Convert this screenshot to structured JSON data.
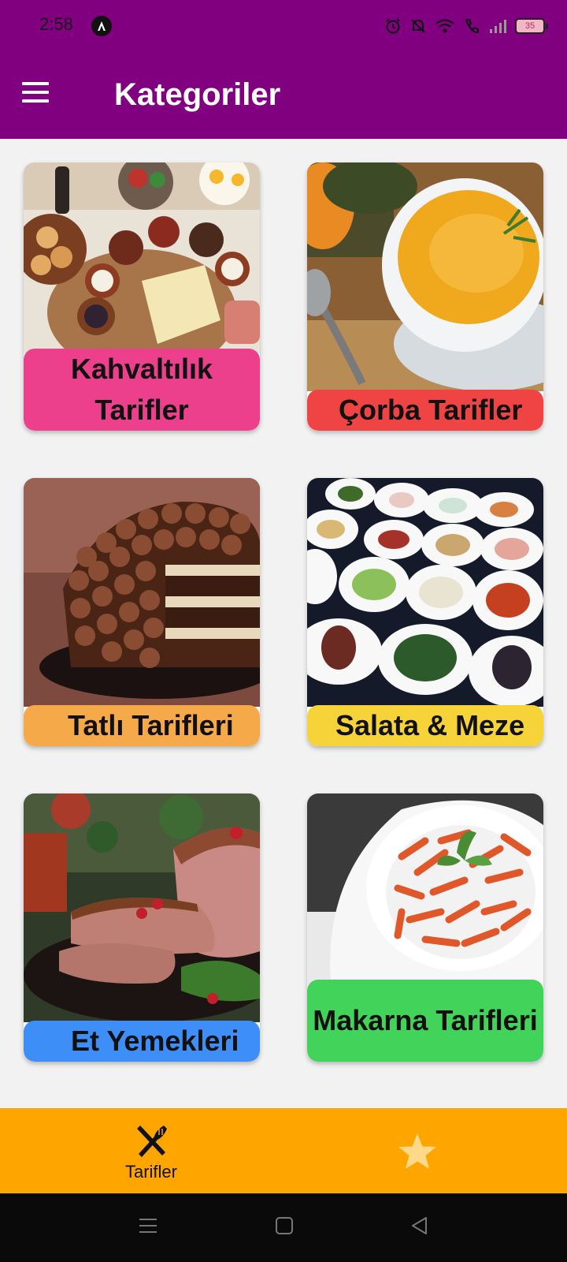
{
  "status_bar": {
    "time": "2:58",
    "battery": "35",
    "icons": [
      "alarm-icon",
      "mute-icon",
      "wifi-icon",
      "call-icon",
      "signal-icon",
      "battery-icon"
    ]
  },
  "app_bar": {
    "title": "Kategoriler",
    "menu_icon": "hamburger-menu-icon",
    "background": "#800080"
  },
  "categories": [
    {
      "label": "Kahvaltılık Tarifler",
      "color": "#ec3f8c",
      "image": "breakfast-spread"
    },
    {
      "label": "Çorba Tarifler",
      "color": "#f04444",
      "image": "pumpkin-soup"
    },
    {
      "label": "Tatlı Tarifleri",
      "color": "#f5a948",
      "image": "chocolate-cake"
    },
    {
      "label": "Salata & Meze",
      "color": "#f7d33a",
      "image": "meze-plates"
    },
    {
      "label": "Et Yemekleri",
      "color": "#3d8ef7",
      "image": "roast-meat"
    },
    {
      "label": "Makarna Tarifleri",
      "color": "#42d35a",
      "image": "penne-pasta"
    }
  ],
  "bottom_nav": {
    "background": "#ffa500",
    "items": [
      {
        "label": "Tarifler",
        "icon": "fork-knife-icon",
        "active": true
      },
      {
        "label": "",
        "icon": "star-icon",
        "active": false
      }
    ]
  },
  "system_nav": [
    "recents-icon",
    "home-icon",
    "back-icon"
  ]
}
